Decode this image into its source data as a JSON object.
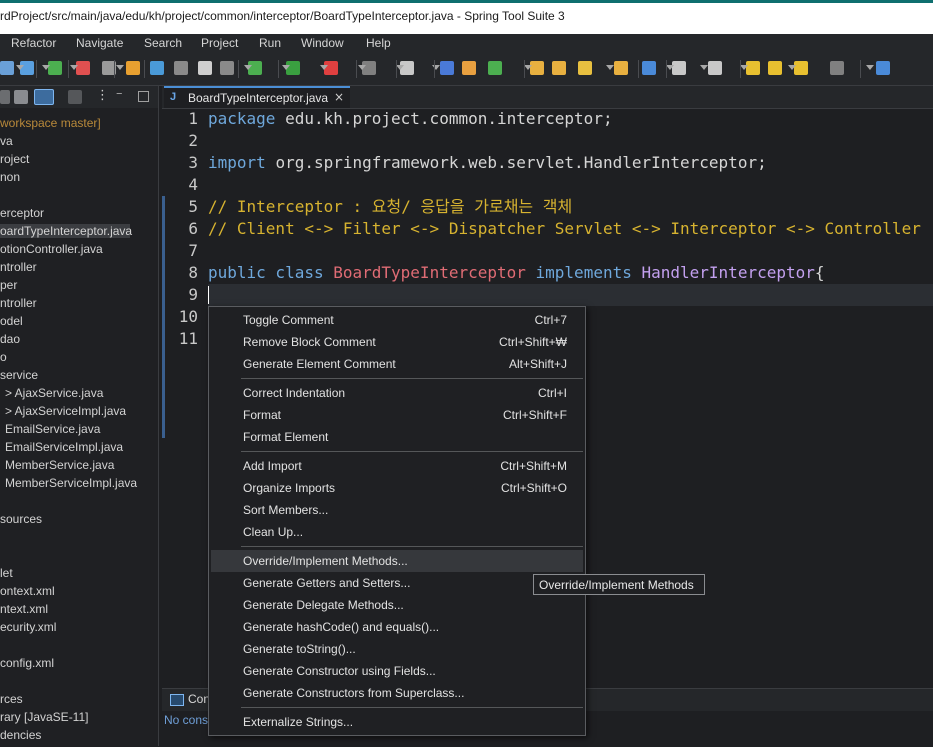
{
  "window": {
    "title": "rdProject/src/main/java/edu/kh/project/common/interceptor/BoardTypeInterceptor.java - Spring Tool Suite 3"
  },
  "menubar": [
    "Refactor",
    "Navigate",
    "Search",
    "Project",
    "Run",
    "Window",
    "Help"
  ],
  "explorer": {
    "items": [
      {
        "text": "workspace master]",
        "kind": "git"
      },
      {
        "text": "va",
        "kind": "normal"
      },
      {
        "text": "roject",
        "kind": "normal"
      },
      {
        "text": "non",
        "kind": "normal"
      },
      {
        "text": "",
        "kind": "blank"
      },
      {
        "text": "erceptor",
        "kind": "normal"
      },
      {
        "text": "oardTypeInterceptor.java",
        "kind": "selected"
      },
      {
        "text": "otionController.java",
        "kind": "normal"
      },
      {
        "text": "ntroller",
        "kind": "normal"
      },
      {
        "text": "per",
        "kind": "normal"
      },
      {
        "text": "ntroller",
        "kind": "normal"
      },
      {
        "text": "odel",
        "kind": "normal"
      },
      {
        "text": "dao",
        "kind": "normal"
      },
      {
        "text": "o",
        "kind": "normal"
      },
      {
        "text": "service",
        "kind": "normal"
      },
      {
        "text": "> AjaxService.java",
        "kind": "arrow"
      },
      {
        "text": "> AjaxServiceImpl.java",
        "kind": "arrow"
      },
      {
        "text": "EmailService.java",
        "kind": "indent"
      },
      {
        "text": "EmailServiceImpl.java",
        "kind": "indent"
      },
      {
        "text": "MemberService.java",
        "kind": "indent"
      },
      {
        "text": "MemberServiceImpl.java",
        "kind": "indent"
      },
      {
        "text": "",
        "kind": "blank"
      },
      {
        "text": "sources",
        "kind": "normal"
      },
      {
        "text": "",
        "kind": "blank"
      },
      {
        "text": "",
        "kind": "blank"
      },
      {
        "text": "let",
        "kind": "normal"
      },
      {
        "text": "ontext.xml",
        "kind": "normal"
      },
      {
        "text": "ntext.xml",
        "kind": "normal"
      },
      {
        "text": "ecurity.xml",
        "kind": "normal"
      },
      {
        "text": "",
        "kind": "blank"
      },
      {
        "text": "config.xml",
        "kind": "normal"
      },
      {
        "text": "",
        "kind": "blank"
      },
      {
        "text": "rces",
        "kind": "normal"
      },
      {
        "text": "rary [JavaSE-11]",
        "kind": "lib"
      },
      {
        "text": "dencies",
        "kind": "normal"
      }
    ]
  },
  "editor": {
    "tab_label": "BoardTypeInterceptor.java",
    "tab_icon": "J",
    "tab_close": "×",
    "lines": [
      {
        "n": "1",
        "parts": [
          {
            "t": "package ",
            "c": "kw"
          },
          {
            "t": "edu.kh.project.common.interceptor;",
            "c": "plain"
          }
        ]
      },
      {
        "n": "2",
        "parts": []
      },
      {
        "n": "3",
        "parts": [
          {
            "t": "import ",
            "c": "kw"
          },
          {
            "t": "org.springframework.web.servlet.HandlerInterceptor;",
            "c": "plain"
          }
        ]
      },
      {
        "n": "4",
        "parts": []
      },
      {
        "n": "5",
        "parts": [
          {
            "t": "// Interceptor : 요청/ 응답을 가로채는 객체",
            "c": "cm"
          }
        ]
      },
      {
        "n": "6",
        "parts": [
          {
            "t": "// Client <-> Filter <-> Dispatcher Servlet <-> Interceptor <-> Controller",
            "c": "cm"
          }
        ]
      },
      {
        "n": "7",
        "parts": []
      },
      {
        "n": "8",
        "parts": [
          {
            "t": "public class ",
            "c": "kw"
          },
          {
            "t": "BoardTypeInterceptor",
            "c": "cls"
          },
          {
            "t": " implements ",
            "c": "kw"
          },
          {
            "t": "HandlerInterceptor",
            "c": "iface"
          },
          {
            "t": "{",
            "c": "plain"
          }
        ]
      },
      {
        "n": "9",
        "parts": []
      },
      {
        "n": "10",
        "parts": []
      },
      {
        "n": "11",
        "parts": []
      }
    ]
  },
  "console": {
    "title": "Con",
    "text": "No cons"
  },
  "context_menu": {
    "groups": [
      [
        {
          "label": "Toggle Comment",
          "shortcut": "Ctrl+7"
        },
        {
          "label": "Remove Block Comment",
          "shortcut": "Ctrl+Shift+₩"
        },
        {
          "label": "Generate Element Comment",
          "shortcut": "Alt+Shift+J"
        }
      ],
      [
        {
          "label": "Correct Indentation",
          "shortcut": "Ctrl+I"
        },
        {
          "label": "Format",
          "shortcut": "Ctrl+Shift+F"
        },
        {
          "label": "Format Element",
          "shortcut": ""
        }
      ],
      [
        {
          "label": "Add Import",
          "shortcut": "Ctrl+Shift+M"
        },
        {
          "label": "Organize Imports",
          "shortcut": "Ctrl+Shift+O"
        },
        {
          "label": "Sort Members...",
          "shortcut": ""
        },
        {
          "label": "Clean Up...",
          "shortcut": ""
        }
      ],
      [
        {
          "label": "Override/Implement Methods...",
          "shortcut": "",
          "hover": true
        },
        {
          "label": "Generate Getters and Setters...",
          "shortcut": ""
        },
        {
          "label": "Generate Delegate Methods...",
          "shortcut": ""
        },
        {
          "label": "Generate hashCode() and equals()...",
          "shortcut": ""
        },
        {
          "label": "Generate toString()...",
          "shortcut": ""
        },
        {
          "label": "Generate Constructor using Fields...",
          "shortcut": ""
        },
        {
          "label": "Generate Constructors from Superclass...",
          "shortcut": ""
        }
      ],
      [
        {
          "label": "Externalize Strings...",
          "shortcut": ""
        }
      ]
    ]
  },
  "tooltip": {
    "text": "Override/Implement Methods"
  },
  "colors": {
    "keyword": "#6fa8dc",
    "comment": "#d7b330",
    "class_name": "#e06c75",
    "interface_name": "#c3a0ef"
  }
}
